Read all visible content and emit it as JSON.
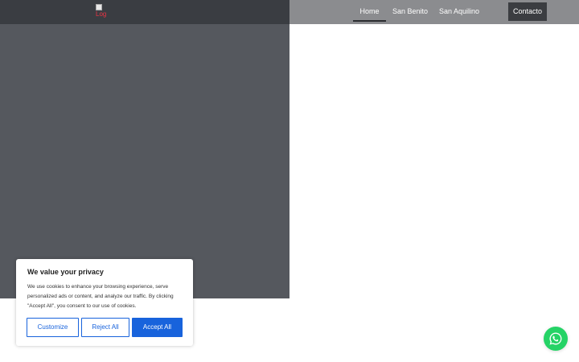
{
  "header": {
    "logo_alt": "Log",
    "nav": [
      {
        "label": "Home",
        "active": true
      },
      {
        "label": "San Benito"
      },
      {
        "label": "San Aquilino"
      }
    ],
    "contact_label": "Contacto"
  },
  "cookie_banner": {
    "title": "We value your privacy",
    "text": "We use cookies to enhance your browsing experience, serve personalized ads or content, and analyze our traffic. By clicking \"Accept All\", you consent to our use of cookies.",
    "customize_label": "Customize",
    "reject_label": "Reject All",
    "accept_label": "Accept All"
  },
  "floating": {
    "whatsapp_icon": "whatsapp-icon"
  },
  "colors": {
    "header_left": "#3a3d42",
    "header_right": "#8b8c8f",
    "hero": "#55585e",
    "accent": "#1863dc",
    "whatsapp": "#25d366"
  }
}
